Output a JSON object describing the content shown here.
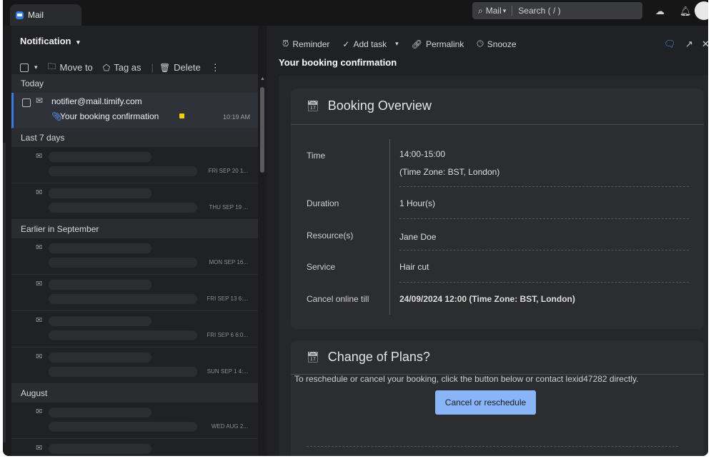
{
  "topbar": {
    "tab_label": "Mail",
    "search_scope": "Mail",
    "search_placeholder": "Search ( / )",
    "icons": [
      "cloud-icon",
      "bell-icon"
    ]
  },
  "left_panel": {
    "folder_title": "Notification",
    "toolbar": {
      "move_to": "Move to",
      "tag_as": "Tag as",
      "delete": "Delete"
    },
    "groups": [
      {
        "label": "Today"
      },
      {
        "label": "Last 7 days"
      },
      {
        "label": "Earlier in September"
      },
      {
        "label": "August"
      }
    ],
    "selected_item": {
      "sender": "notifier@mail.timify.com",
      "subject": "Your booking confirmation",
      "time": "10:19 AM",
      "flag_color": "#f4d000"
    },
    "placeholder_dates": [
      "FRI SEP 20 1...",
      "THU SEP 19 ...",
      "MON SEP 16...",
      "FRI SEP 13 6:...",
      "FRI SEP 6 6:0...",
      "SUN SEP 1 4:...",
      "WED AUG 2..."
    ]
  },
  "reader": {
    "toolbar": {
      "reminder": "Reminder",
      "add_task": "Add task",
      "permalink": "Permalink",
      "snooze": "Snooze"
    },
    "subject": "Your booking confirmation",
    "booking_overview": {
      "title": "Booking Overview",
      "rows": [
        {
          "label": "Time",
          "value": "14:00-15:00",
          "extra": "(Time Zone: BST, London)"
        },
        {
          "label": "Duration",
          "value": "1 Hour(s)"
        },
        {
          "label": "Resource(s)",
          "value": "Jane Doe"
        },
        {
          "label": "Service",
          "value": "Hair cut"
        },
        {
          "label": "Cancel online till",
          "value": "24/09/2024 12:00 (Time Zone: BST, London)"
        }
      ]
    },
    "change_of_plans": {
      "title": "Change of Plans?",
      "text": "To reschedule or cancel your booking, click the button below or contact lexid47282 directly.",
      "button": "Cancel or reschedule"
    }
  },
  "colors": {
    "accent": "#3b7bdc",
    "button": "#8ab4f8"
  }
}
